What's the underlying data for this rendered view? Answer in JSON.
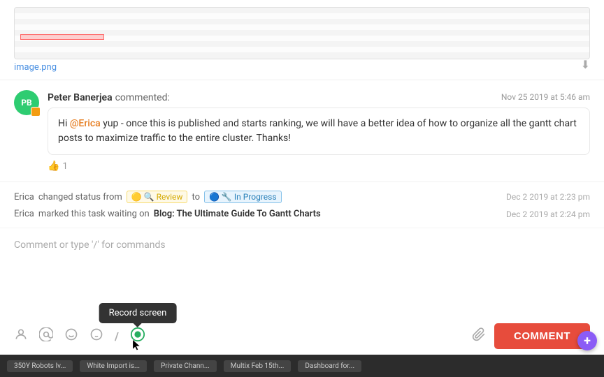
{
  "image": {
    "filename": "image.png",
    "download_label": "⬇"
  },
  "comment": {
    "avatar_initials": "PB",
    "commenter_name": "Peter Banerjea",
    "action": "commented:",
    "timestamp": "Nov 25 2019 at 5:46 am",
    "mention": "@Erica",
    "body": " yup - once this is published and starts ranking, we will have a better idea of how to organize all the gantt chart posts to maximize traffic to the entire cluster. Thanks!",
    "like_count": "1"
  },
  "status_changes": [
    {
      "actor": "Erica",
      "action": "changed status from",
      "from_status": "Review",
      "to_text": "to",
      "to_status": "In Progress",
      "timestamp": "Dec 2 2019 at 2:23 pm"
    },
    {
      "actor": "Erica",
      "action": "marked this task waiting on",
      "task_link": "Blog: The Ultimate Guide To Gantt Charts",
      "timestamp": "Dec 2 2019 at 2:24 pm"
    }
  ],
  "input": {
    "placeholder": "Comment or type '/' for commands"
  },
  "toolbar": {
    "comment_button_label": "COMMENT",
    "record_screen_tooltip": "Record screen",
    "icons": [
      {
        "name": "person-icon",
        "symbol": "👤"
      },
      {
        "name": "at-icon",
        "symbol": "@"
      },
      {
        "name": "smile-icon",
        "symbol": "😊"
      },
      {
        "name": "emoji-icon",
        "symbol": "🙂"
      },
      {
        "name": "slash-icon",
        "symbol": "/"
      },
      {
        "name": "record-icon",
        "symbol": "⏺"
      }
    ]
  },
  "taskbar": {
    "items": [
      "350Y Robots Iv...",
      "White Import is...",
      "Private Chann...",
      "Multix Feb 15th...",
      "Dashboard for..."
    ]
  },
  "colors": {
    "accent_green": "#27ae60",
    "comment_button": "#e74c3c",
    "mention_color": "#e67e22",
    "avatar_bg": "#27ae60",
    "avatar_badge": "#f39c12"
  }
}
